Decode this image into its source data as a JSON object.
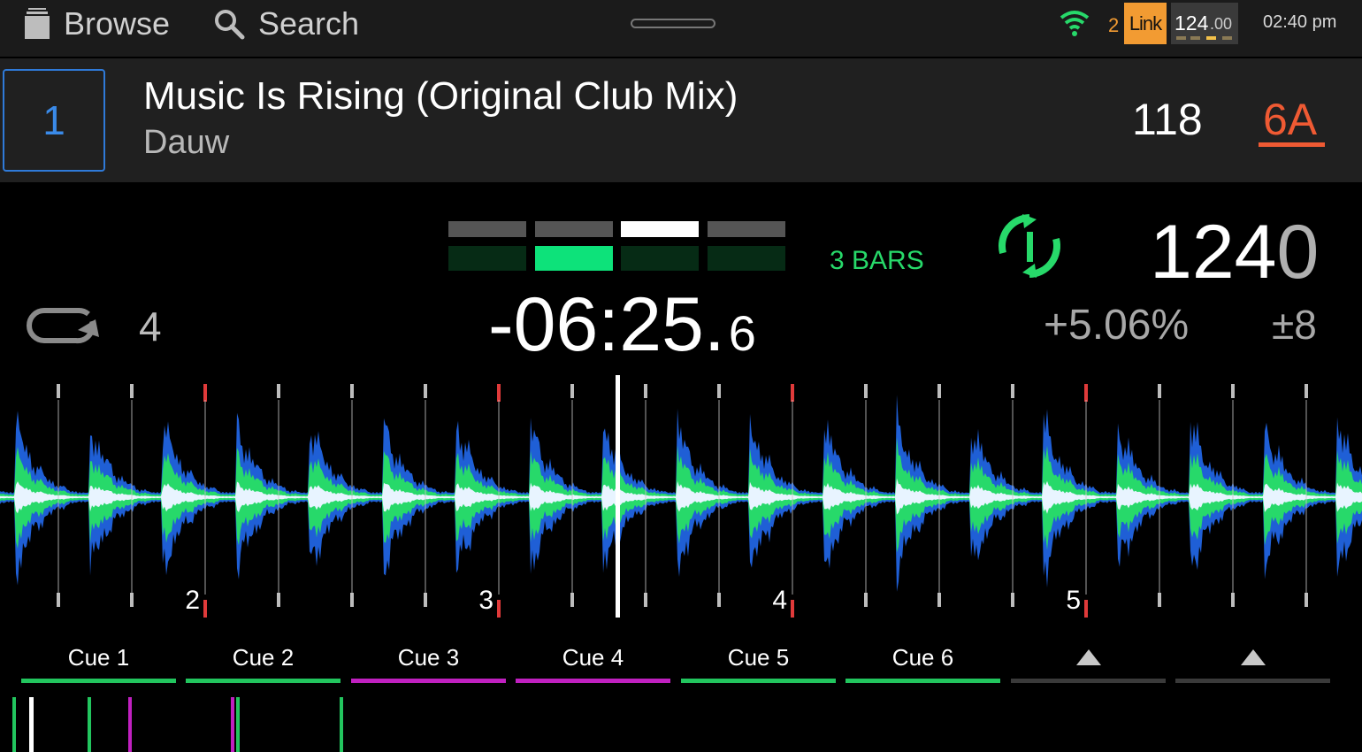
{
  "topbar": {
    "browse_label": "Browse",
    "search_label": "Search",
    "link_peers": "2",
    "link_label": "Link",
    "master_bpm_int": "124",
    "master_bpm_dec": ".00",
    "time": "02:40 pm"
  },
  "track": {
    "deck_number": "1",
    "title": "Music Is Rising (Original Club Mix)",
    "artist": "Dauw",
    "bpm": "118",
    "key": "6A"
  },
  "deck": {
    "bars_label": "3 BARS",
    "tempo_int": "124",
    "tempo_dec": "0",
    "loop_size": "4",
    "time_remaining_main": "-06:25.",
    "time_remaining_dec": "6",
    "pitch_percent": "+5.06%",
    "pitch_range": "±8",
    "phrase_beat_active": 2,
    "beat_top_active": 3
  },
  "waveform": {
    "bar_numbers": [
      "2",
      "3",
      "4",
      "5"
    ],
    "colors": {
      "low": "#1f5fd6",
      "mid": "#27d96a",
      "high": "#e8f4ff",
      "cue_marker": "#e03a3a",
      "beat_tick": "#bdbdbd"
    }
  },
  "cue_pads": [
    {
      "label": "Cue 1",
      "color": "#22c55e"
    },
    {
      "label": "Cue 2",
      "color": "#22c55e"
    },
    {
      "label": "Cue 3",
      "color": "#c020c0"
    },
    {
      "label": "Cue 4",
      "color": "#c020c0"
    },
    {
      "label": "Cue 5",
      "color": "#22c55e"
    },
    {
      "label": "Cue 6",
      "color": "#22c55e"
    },
    {
      "label": "",
      "color": "#3a3a3a"
    },
    {
      "label": "",
      "color": "#3a3a3a"
    }
  ],
  "overview_markers": [
    {
      "color": "#22c55e"
    },
    {
      "color": "#ffffff"
    },
    {
      "color": "#22c55e"
    },
    {
      "color": "#c020c0"
    },
    {
      "color": "#c020c0"
    },
    {
      "color": "#22c55e"
    },
    {
      "color": "#22c55e"
    }
  ],
  "icons": {
    "browse": "folder-stack-icon",
    "search": "search-icon",
    "wifi": "wifi-icon",
    "sync": "sync-icon",
    "loop": "loop-icon",
    "pad_arrow": "triangle-up-icon"
  }
}
